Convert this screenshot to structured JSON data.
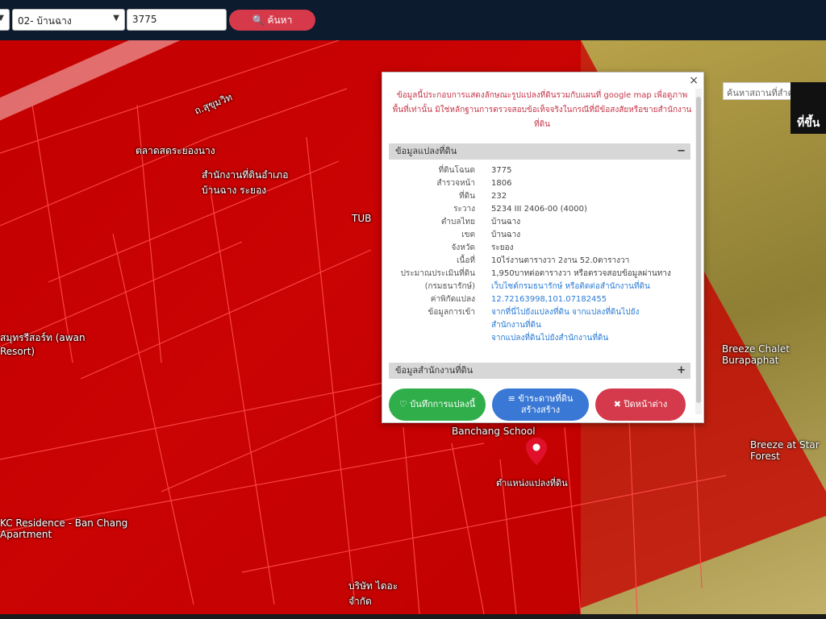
{
  "toolbar": {
    "province_select": "02- บ้านฉาง",
    "parcel_input": "3775",
    "search_label": "ค้นหา"
  },
  "map": {
    "place_search_placeholder": "ค้นหาสถานที่สำคัญ",
    "side_button_label": "ที่ขึ้น",
    "labels": {
      "road": "ถ.สุขุมวิท",
      "market": "ตลาดสดระยองนาง",
      "district": "สำนักงานที่ดินอำเภอบ้านฉาง ระยอง",
      "tub": "TUB",
      "resort": "สมุทรรีสอร์ท (awan Resort)",
      "breeze_chalet": "Breeze Chalet Burapaphat",
      "breeze_star": "Breeze at Star Forest",
      "school": "Banchang School",
      "pin_label": "ตำแหน่งแปลงที่ดิน",
      "kc": "KC Residence - Ban Chang Apartment",
      "company": "บริษัท ไดอะ จำกัด"
    }
  },
  "popup": {
    "notice": "ข้อมูลนี้ประกอบการแสดงลักษณะรูปแปลงที่ดินรวมกับแผนที่ google map เพื่อดูภาพพื้นที่เท่านั้น มิใช่หลักฐานการตรวจสอบข้อเท็จจริงในกรณีที่มีข้อสงสัยหรือขายสำนักงานที่ดิน",
    "section_land": "ข้อมูลแปลงที่ดิน",
    "section_land_sign": "−",
    "fields": [
      {
        "label": "ที่ดินโฉนด",
        "value": "3775"
      },
      {
        "label": "สำรวจหน้า",
        "value": "1806"
      },
      {
        "label": "ที่ดิน",
        "value": "232"
      },
      {
        "label": "ระวาง",
        "value": "5234 III 2406-00 (4000)"
      },
      {
        "label": "ตำบลไทย",
        "value": "บ้านฉาง"
      },
      {
        "label": "เขต",
        "value": "บ้านฉาง"
      },
      {
        "label": "จังหวัด",
        "value": "ระยอง"
      },
      {
        "label": "เนื้อที่",
        "value": "10ไร่งานตารางวา 2งาน 52.0ตารางวา"
      },
      {
        "label": "ประมาณประเมินที่ดิน",
        "value": "1,950บาทต่อตารางวา หรือตรวจสอบข้อมูลผ่านทาง"
      },
      {
        "label": "(กรมธนารักษ์)",
        "value": "เว็บไซต์กรมธนารักษ์ หรือติดต่อสำนักงานที่ดิน"
      },
      {
        "label": "ค่าพิกัดแปลง",
        "value": "12.72163998,101.07182455"
      },
      {
        "label": "ข้อมูลการเข้า",
        "value": "จากที่นี่ไปยังแปลงที่ดิน จากแปลงที่ดินไปยัง"
      },
      {
        "label": "",
        "value": "สำนักงานที่ดิน"
      },
      {
        "label": "",
        "value": "จากแปลงที่ดินไปยังสำนักงานที่ดิน"
      }
    ],
    "section_office": "ข้อมูลสำนักงานที่ดิน",
    "section_office_sign": "+",
    "buttons": {
      "save": "♡ บันทึกการแปลงนี้",
      "share": "≡ ข้าระดาษที่ดิน สร้างสร้าง",
      "close": "✖ ปิดหน้าต่าง"
    },
    "close_glyph": "×"
  },
  "colors": {
    "topbar": "#0d1b2e",
    "search_button": "#d63a4a",
    "save_button": "#2fae4a",
    "share_button": "#3a78d6",
    "close_button": "#d43a4c"
  }
}
